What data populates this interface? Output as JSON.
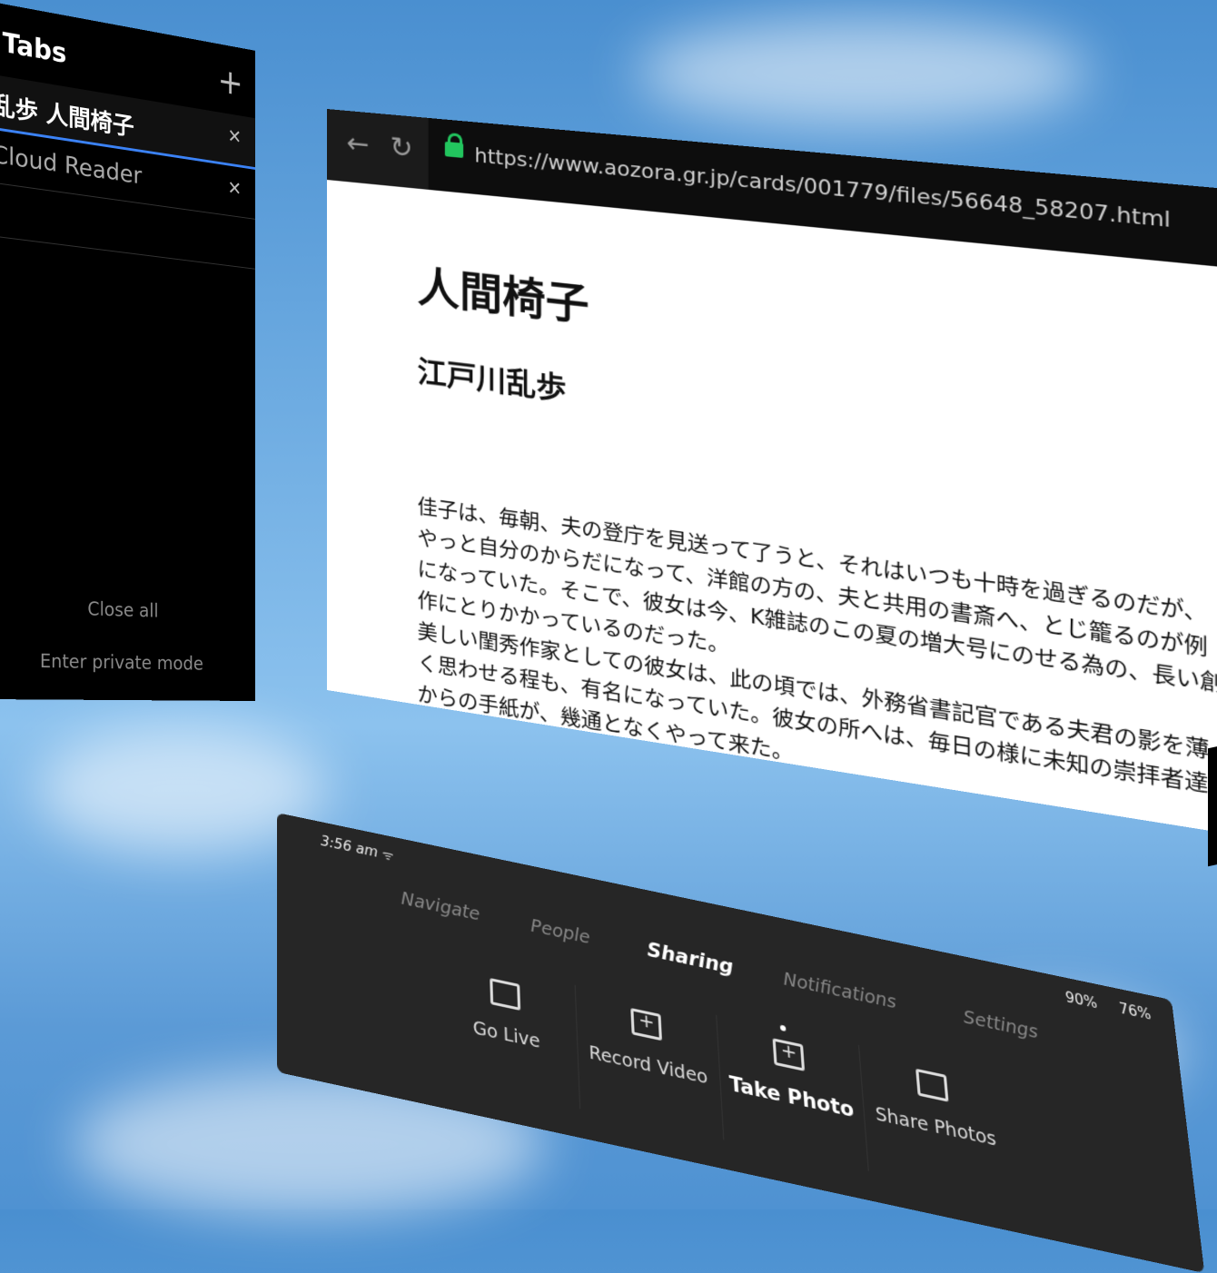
{
  "tabs_panel": {
    "title": "Tabs",
    "add_icon": "plus-icon",
    "tabs": [
      {
        "label": "乱歩 人間椅子",
        "active": true
      },
      {
        "label": "Cloud Reader",
        "active": false
      },
      {
        "label": "",
        "active": false
      }
    ],
    "close_all": "Close all",
    "private_mode": "Enter private mode"
  },
  "browser": {
    "url": "https://www.aozora.gr.jp/cards/001779/files/56648_58207.html",
    "back_icon": "back-arrow-icon",
    "reload_icon": "reload-icon",
    "lock_icon": "lock-icon",
    "bookmark_icon": "bookmark-icon",
    "page": {
      "title": "人間椅子",
      "author": "江戸川乱歩",
      "paragraph1": "佳子は、毎朝、夫の登庁を見送って了うと、それはいつも十時を過ぎるのだが、やっと自分のからだになって、洋館の方の、夫と共用の書斎へ、とじ籠るのが例になっていた。そこで、彼女は今、K雑誌のこの夏の増大号にのせる為の、長い創作にとりかかっているのだった。",
      "paragraph2": "美しい閨秀作家としての彼女は、此の頃では、外務省書記官である夫君の影を薄く思わせる程も、有名になっていた。彼女の所へは、毎日の様に未知の崇拝者達からの手紙が、幾通となくやって来た。"
    }
  },
  "menu": {
    "time": "3:56 am",
    "battery_controller": "90%",
    "battery_headset": "76%",
    "tabs": [
      "Navigate",
      "People",
      "Sharing",
      "Notifications",
      "Settings"
    ],
    "active_tab": "Sharing",
    "actions": [
      {
        "label": "Go Live",
        "icon": "go-live-icon"
      },
      {
        "label": "Record Video",
        "icon": "record-video-icon"
      },
      {
        "label": "Take Photo",
        "icon": "take-photo-icon",
        "active": true
      },
      {
        "label": "Share Photos",
        "icon": "share-photos-icon"
      }
    ]
  },
  "colors": {
    "sky": "#6aa9e0",
    "panel": "#262626",
    "accent": "#3b82f6",
    "lock": "#22c55e"
  }
}
